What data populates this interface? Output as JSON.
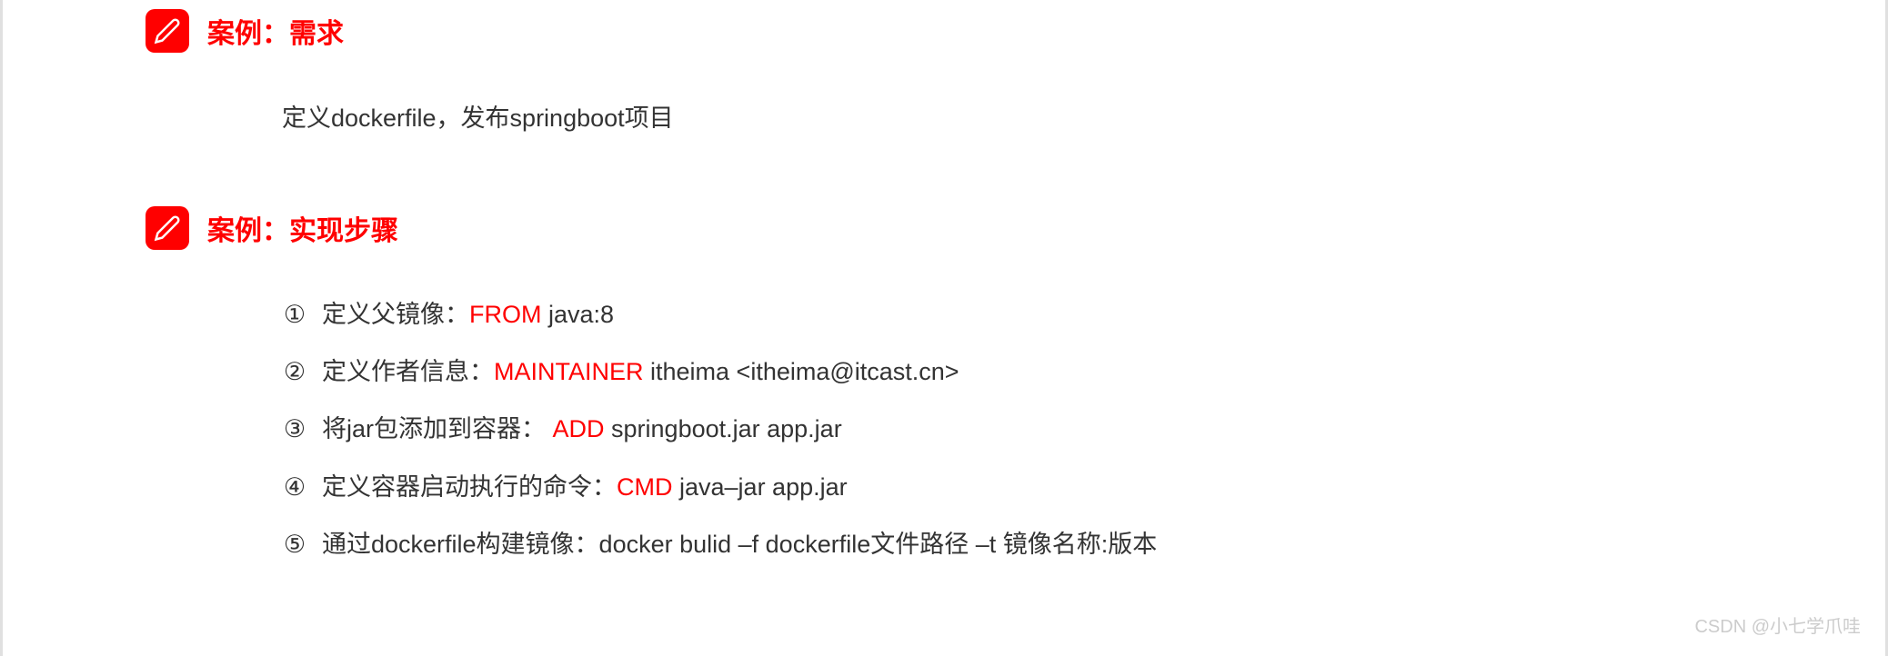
{
  "section1": {
    "title": "案例：需求",
    "content": "定义dockerfile，发布springboot项目"
  },
  "section2": {
    "title": "案例：实现步骤",
    "steps": [
      {
        "num": "①",
        "label": "定义父镜像：",
        "keyword": "FROM",
        "rest": " java:8"
      },
      {
        "num": "②",
        "label": "定义作者信息：",
        "keyword": "MAINTAINER ",
        "rest": " itheima <itheima@itcast.cn>"
      },
      {
        "num": "③",
        "label": "将jar包添加到容器： ",
        "keyword": "ADD",
        "rest": " springboot.jar app.jar"
      },
      {
        "num": "④",
        "label": "定义容器启动执行的命令：",
        "keyword": "CMD",
        "rest": " java–jar app.jar"
      },
      {
        "num": "⑤",
        "label": "通过dockerfile构建镜像：docker bulid –f dockerfile文件路径 –t 镜像名称:版本",
        "keyword": "",
        "rest": ""
      }
    ]
  },
  "watermark": "CSDN @小七学爪哇"
}
